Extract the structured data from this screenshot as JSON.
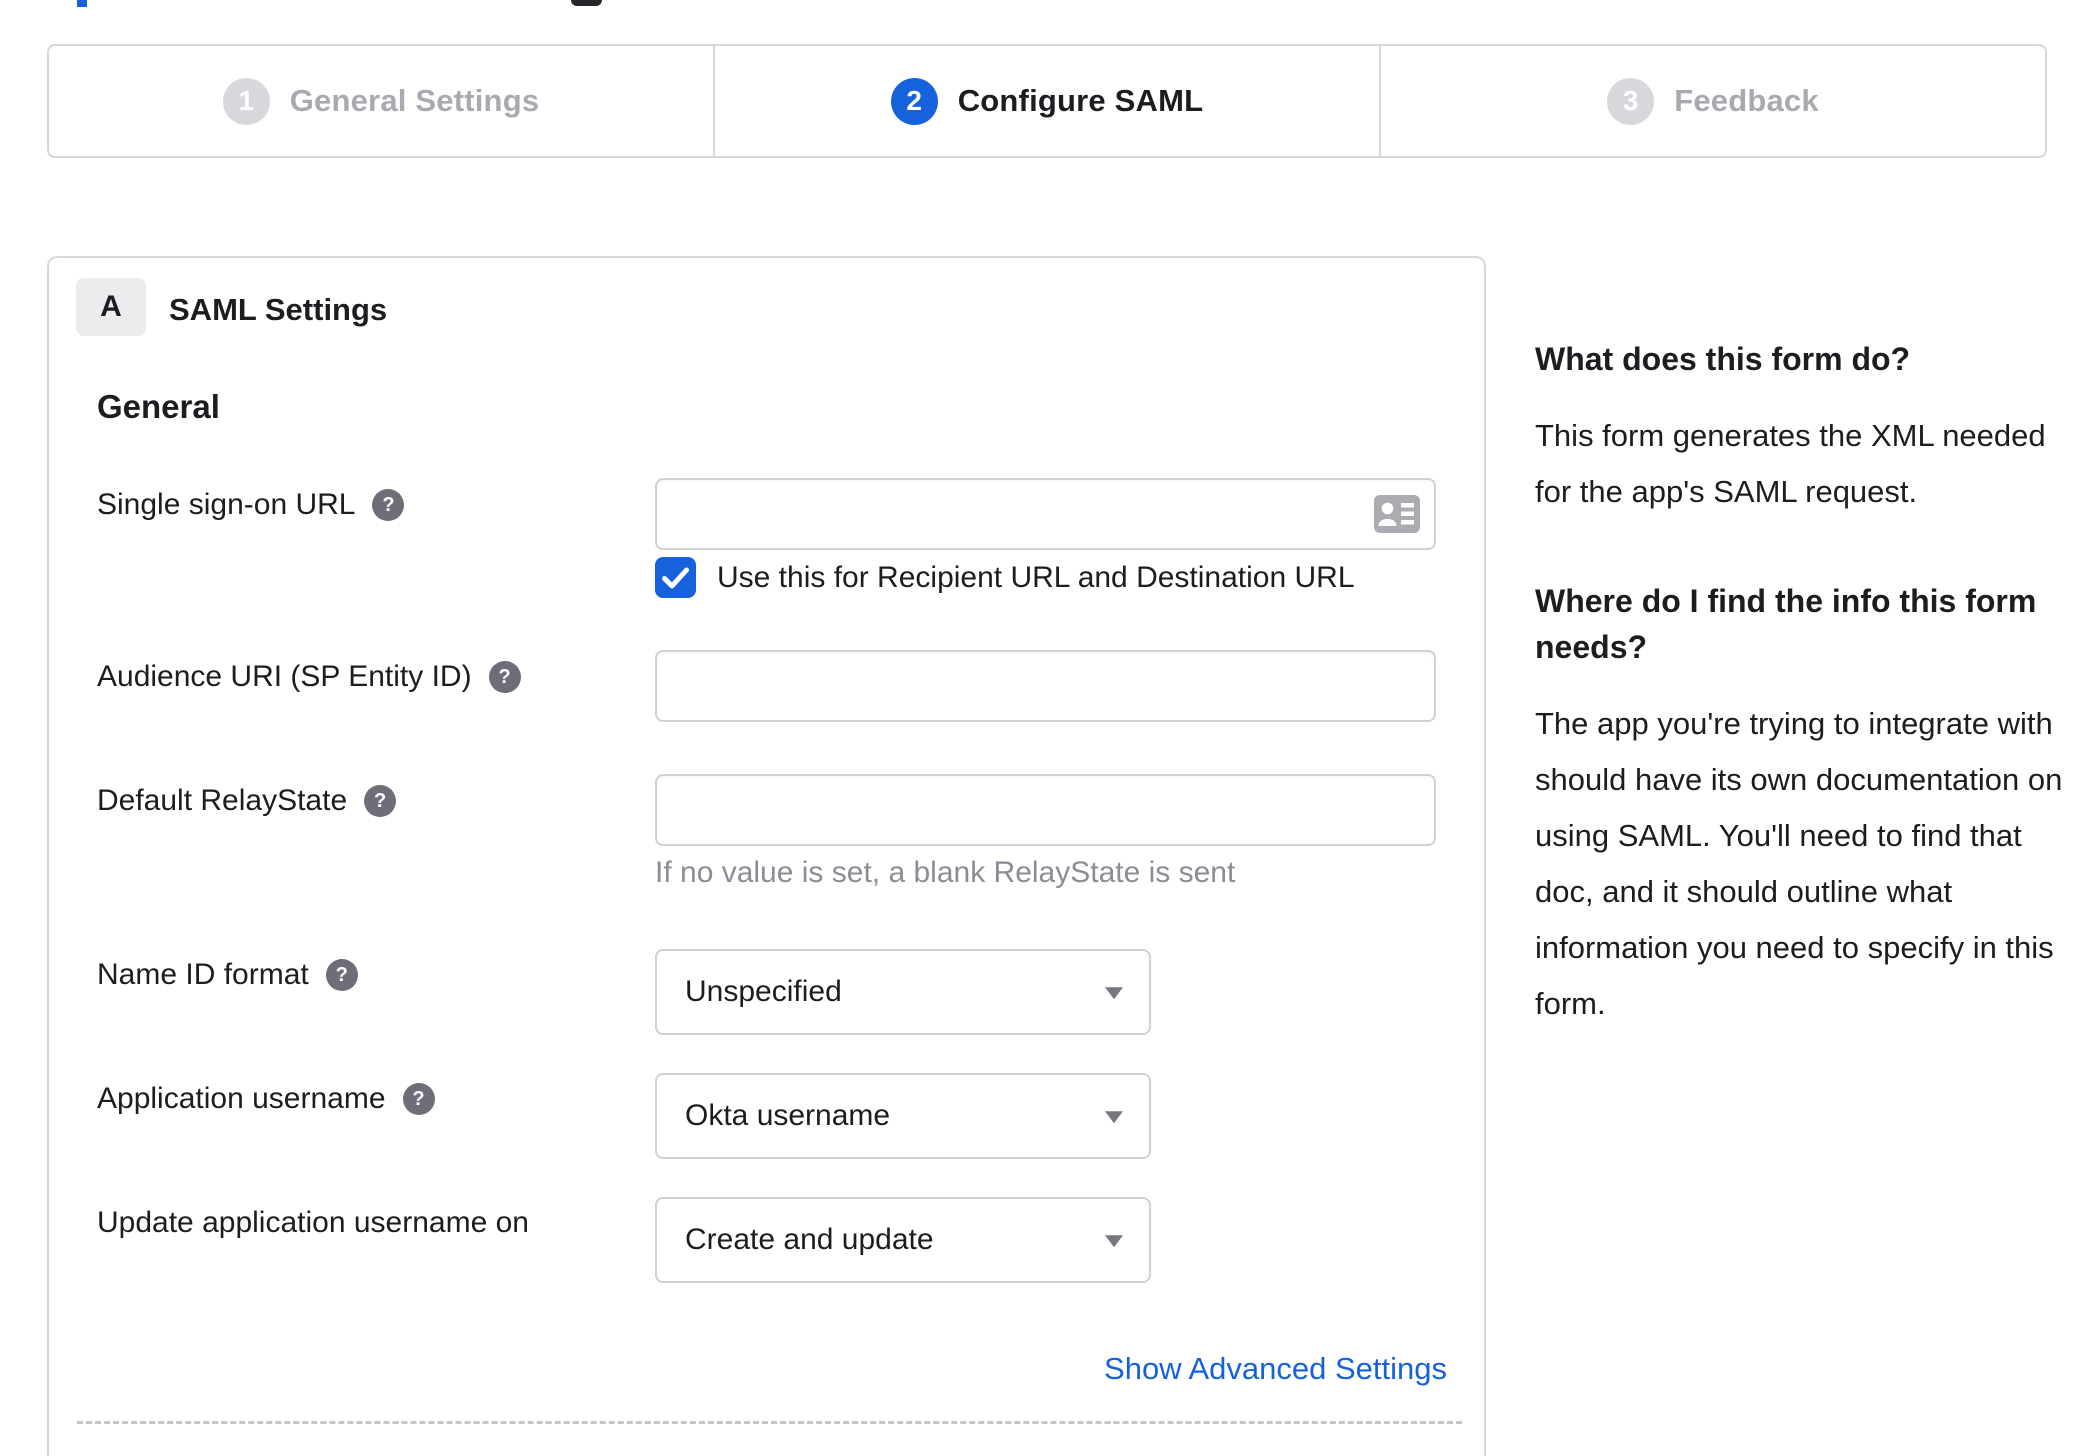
{
  "colors": {
    "accent": "#1662dd",
    "border": "#d8d8dc",
    "text": "#1d1d21",
    "muted_text": "#8c8c96",
    "step_inactive_circle": "#d7d7dc",
    "step_inactive_label": "#a9a9b2",
    "help_icon_bg": "#6e6e78",
    "card_icon_gray": "#ababb1"
  },
  "stepper": {
    "steps": [
      {
        "number": "1",
        "label": "General Settings",
        "active": false
      },
      {
        "number": "2",
        "label": "Configure SAML",
        "active": true
      },
      {
        "number": "3",
        "label": "Feedback",
        "active": false
      }
    ]
  },
  "panel": {
    "badge": "A",
    "title": "SAML Settings",
    "section_heading": "General",
    "fields": {
      "sso_url": {
        "label": "Single sign-on URL",
        "value": "",
        "help_icon": "question-mark-icon",
        "input_icon": "contact-card-icon",
        "checkbox_label": "Use this for Recipient URL and Destination URL",
        "checkbox_checked": true
      },
      "audience_uri": {
        "label": "Audience URI (SP Entity ID)",
        "value": "",
        "help_icon": "question-mark-icon"
      },
      "default_relay_state": {
        "label": "Default RelayState",
        "value": "",
        "help_icon": "question-mark-icon",
        "hint": "If no value is set, a blank RelayState is sent"
      },
      "name_id_format": {
        "label": "Name ID format",
        "value": "Unspecified",
        "help_icon": "question-mark-icon",
        "caret_icon": "caret-down-icon"
      },
      "application_username": {
        "label": "Application username",
        "value": "Okta username",
        "help_icon": "question-mark-icon",
        "caret_icon": "caret-down-icon"
      },
      "update_application_username_on": {
        "label": "Update application username on",
        "value": "Create and update",
        "caret_icon": "caret-down-icon"
      }
    },
    "advanced_link": "Show Advanced Settings"
  },
  "sidebar": {
    "sections": [
      {
        "heading": "What does this form do?",
        "body": "This form generates the XML needed for the app's SAML request."
      },
      {
        "heading": "Where do I find the info this form needs?",
        "body": "The app you're trying to integrate with should have its own documentation on using SAML. You'll need to find that doc, and it should outline what information you need to specify in this form."
      }
    ]
  }
}
